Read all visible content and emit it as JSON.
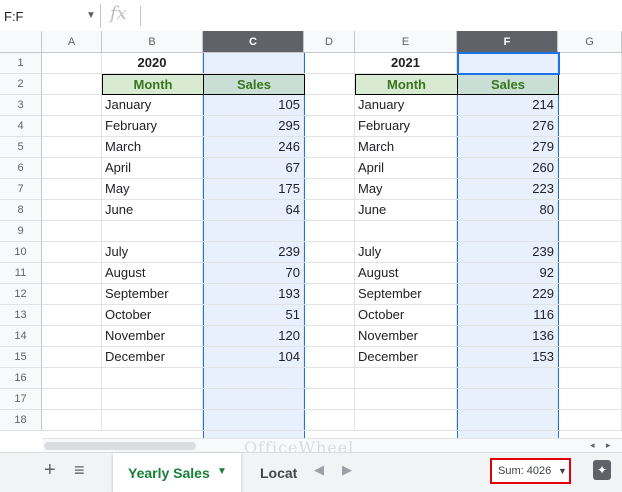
{
  "formula_bar": {
    "name_box": "F:F",
    "fx": "fx"
  },
  "columns": [
    "A",
    "B",
    "C",
    "D",
    "E",
    "F",
    "G"
  ],
  "rows": [
    "1",
    "2",
    "3",
    "4",
    "5",
    "6",
    "7",
    "8",
    "9",
    "10",
    "11",
    "12",
    "13",
    "14",
    "15",
    "16",
    "17",
    "18"
  ],
  "table_2020": {
    "year": "2020",
    "month_header": "Month",
    "sales_header": "Sales",
    "rows": [
      {
        "month": "January",
        "sales": "105"
      },
      {
        "month": "February",
        "sales": "295"
      },
      {
        "month": "March",
        "sales": "246"
      },
      {
        "month": "April",
        "sales": "67"
      },
      {
        "month": "May",
        "sales": "175"
      },
      {
        "month": "June",
        "sales": "64"
      },
      {
        "month": "",
        "sales": ""
      },
      {
        "month": "July",
        "sales": "239"
      },
      {
        "month": "August",
        "sales": "70"
      },
      {
        "month": "September",
        "sales": "193"
      },
      {
        "month": "October",
        "sales": "51"
      },
      {
        "month": "November",
        "sales": "120"
      },
      {
        "month": "December",
        "sales": "104"
      }
    ]
  },
  "table_2021": {
    "year": "2021",
    "month_header": "Month",
    "sales_header": "Sales",
    "rows": [
      {
        "month": "January",
        "sales": "214"
      },
      {
        "month": "February",
        "sales": "276"
      },
      {
        "month": "March",
        "sales": "279"
      },
      {
        "month": "April",
        "sales": "260"
      },
      {
        "month": "May",
        "sales": "223"
      },
      {
        "month": "June",
        "sales": "80"
      },
      {
        "month": "",
        "sales": ""
      },
      {
        "month": "July",
        "sales": "239"
      },
      {
        "month": "August",
        "sales": "92"
      },
      {
        "month": "September",
        "sales": "229"
      },
      {
        "month": "October",
        "sales": "116"
      },
      {
        "month": "November",
        "sales": "136"
      },
      {
        "month": "December",
        "sales": "153"
      }
    ]
  },
  "bottom_bar": {
    "add_sheet": "+",
    "all_sheets": "≡",
    "active_tab": "Yearly Sales",
    "second_tab": "Locat",
    "sum_label": "Sum: 4026"
  },
  "watermark": "OfficeWheel",
  "colors": {
    "selection": "#e8f0fe",
    "accent": "#1a73e8",
    "sum_highlight": "#e0000b",
    "tab_green": "#188038"
  }
}
